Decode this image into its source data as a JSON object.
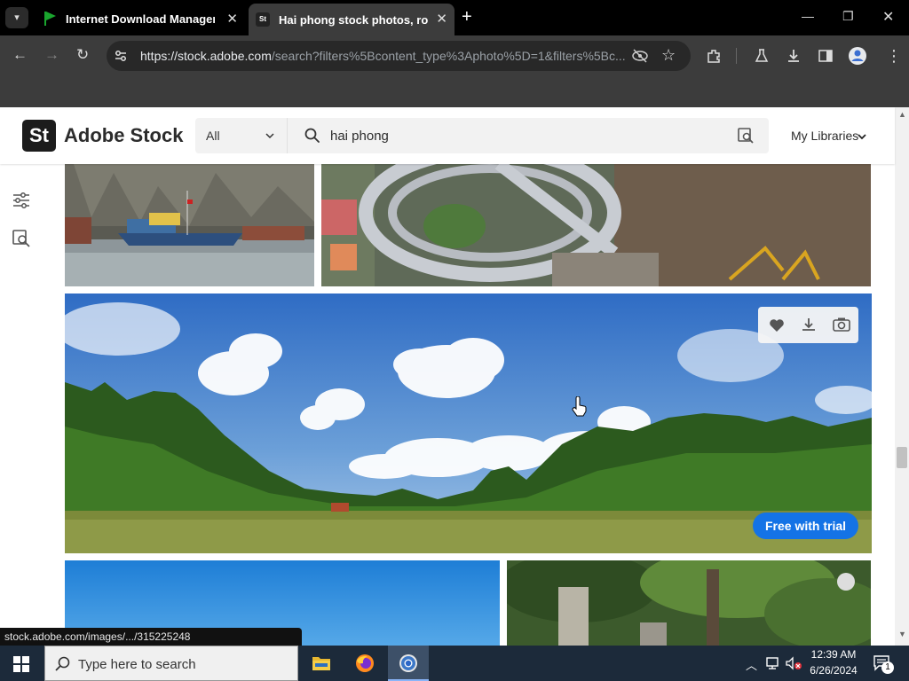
{
  "browser": {
    "tabs": [
      {
        "title": "Internet Download Manager is",
        "active": false
      },
      {
        "title": "Hai phong stock photos, royalt",
        "active": true
      }
    ],
    "new_tab": "+",
    "url_host": "https://stock.adobe.com",
    "url_path": "/search?filters%5Bcontent_type%3Aphoto%5D=1&filters%5Bc...",
    "status_url": "stock.adobe.com/images/.../315225248"
  },
  "header": {
    "logo_text": "St",
    "brand": "Adobe Stock",
    "filter_value": "All",
    "search_value": "hai phong",
    "my_libraries": "My Libraries"
  },
  "results": {
    "trial_badge": "Free with trial"
  },
  "taskbar": {
    "search_placeholder": "Type here to search",
    "time": "12:39 AM",
    "date": "6/26/2024",
    "notifications": "1"
  },
  "colors": {
    "accent": "#1473e6",
    "tab_active": "#3c3c3c",
    "taskbar": "#1c2a3a"
  }
}
